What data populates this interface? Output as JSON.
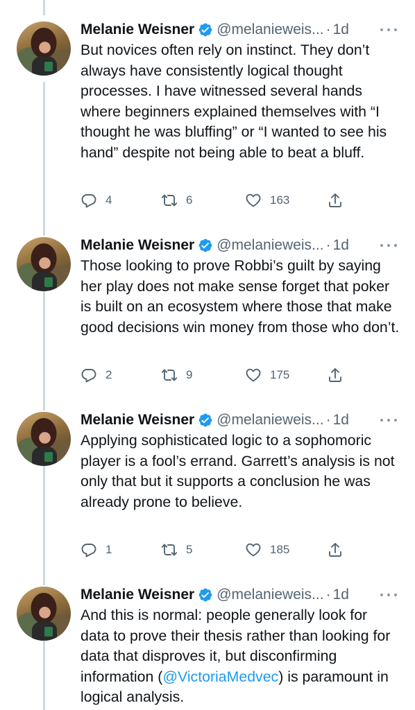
{
  "tweets": [
    {
      "name": "Melanie Weisner",
      "handle": "@melanieweis...",
      "separator": "·",
      "time": "1d",
      "text": "But novices often rely on instinct. They don’t always have consistently logical thought processes. I have witnessed several hands where beginners explained themselves with “I thought he was bluffing” or “I wanted to see his hand” despite not being able to beat a bluff.",
      "replies": "4",
      "retweets": "6",
      "likes": "163"
    },
    {
      "name": "Melanie Weisner",
      "handle": "@melanieweis...",
      "separator": "·",
      "time": "1d",
      "text": "Those looking to prove Robbi’s guilt by saying her play does not make sense forget that poker is built on an ecosystem where those that make good decisions win money from those who don’t.",
      "replies": "2",
      "retweets": "9",
      "likes": "175"
    },
    {
      "name": "Melanie Weisner",
      "handle": "@melanieweis...",
      "separator": "·",
      "time": "1d",
      "text": "Applying sophisticated logic to a sophomoric player is a fool’s errand. Garrett’s analysis is not only that but it supports a conclusion he was already prone to believe.",
      "replies": "1",
      "retweets": "5",
      "likes": "185"
    },
    {
      "name": "Melanie Weisner",
      "handle": "@melanieweis...",
      "separator": "·",
      "time": "1d",
      "text_before": "And this is normal: people generally look for data to prove their thesis rather than looking for data that disproves it, but disconfirming information (",
      "mention": "@VictoriaMedvec",
      "text_after": ") is paramount in logical analysis."
    }
  ],
  "colors": {
    "verified": "#1d9bf0",
    "mention": "#1d9bf0",
    "thread_line": "#cfd9de",
    "secondary_text": "#536471"
  },
  "icons": [
    "reply-icon",
    "retweet-icon",
    "like-icon",
    "share-icon",
    "verified-badge-icon",
    "more-options-icon"
  ]
}
